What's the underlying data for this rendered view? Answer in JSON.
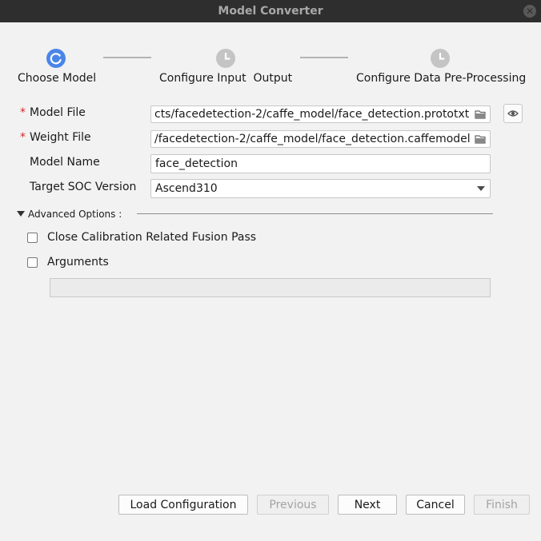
{
  "window": {
    "title": "Model Converter"
  },
  "steps": [
    {
      "label": "Choose Model",
      "state": "active"
    },
    {
      "label": "Configure Input  Output",
      "state": "pending"
    },
    {
      "label": "Configure Data Pre-Processing",
      "state": "pending"
    }
  ],
  "colors": {
    "active_step": "#4a86e8",
    "pending_step": "#c4c4c4",
    "required_marker": "#d42a2a"
  },
  "form": {
    "required_marker": "*",
    "model_file": {
      "label": "Model File",
      "value": "cts/facedetection-2/caffe_model/face_detection.prototxt"
    },
    "weight_file": {
      "label": "Weight File",
      "value": "/facedetection-2/caffe_model/face_detection.caffemodel"
    },
    "model_name": {
      "label": "Model Name",
      "value": "face_detection"
    },
    "target_soc": {
      "label": "Target SOC Version",
      "value": "Ascend310"
    }
  },
  "advanced": {
    "label": "Advanced Options :",
    "options": [
      {
        "label": "Close Calibration Related Fusion Pass",
        "checked": false
      },
      {
        "label": "Arguments",
        "checked": false
      }
    ],
    "arguments_value": ""
  },
  "buttons": {
    "load_configuration": "Load Configuration",
    "previous": "Previous",
    "next": "Next",
    "cancel": "Cancel",
    "finish": "Finish"
  },
  "icons": {
    "close": "close-icon",
    "step_active": "refresh-icon",
    "step_pending": "clock-icon",
    "folder": "folder-icon",
    "preview": "eye-icon"
  }
}
